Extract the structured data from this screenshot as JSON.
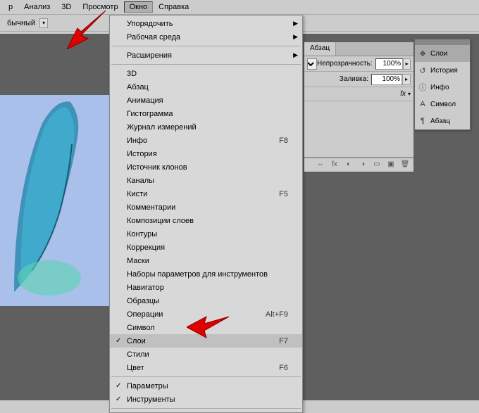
{
  "menubar": {
    "items": [
      "р",
      "Анализ",
      "3D",
      "Просмотр",
      "Окно",
      "Справка"
    ],
    "pressed_index": 4
  },
  "optbar": {
    "label": "бычный"
  },
  "dropdown": {
    "groups": [
      [
        {
          "label": "Упорядочить",
          "sub": true
        },
        {
          "label": "Рабочая среда",
          "sub": true
        }
      ],
      [
        {
          "label": "Расширения",
          "sub": true
        }
      ],
      [
        {
          "label": "3D"
        },
        {
          "label": "Абзац"
        },
        {
          "label": "Анимация"
        },
        {
          "label": "Гистограмма"
        },
        {
          "label": "Журнал измерений"
        },
        {
          "label": "Инфо",
          "shortcut": "F8"
        },
        {
          "label": "История"
        },
        {
          "label": "Источник клонов"
        },
        {
          "label": "Каналы"
        },
        {
          "label": "Кисти",
          "shortcut": "F5"
        },
        {
          "label": "Комментарии"
        },
        {
          "label": "Композиции слоев"
        },
        {
          "label": "Контуры"
        },
        {
          "label": "Коррекция"
        },
        {
          "label": "Маски"
        },
        {
          "label": "Наборы параметров для инструментов"
        },
        {
          "label": "Навигатор"
        },
        {
          "label": "Образцы"
        },
        {
          "label": "Операции",
          "shortcut": "Alt+F9"
        },
        {
          "label": "Символ"
        },
        {
          "label": "Слои",
          "shortcut": "F7",
          "checked": true,
          "highlight": true
        },
        {
          "label": "Стили"
        },
        {
          "label": "Цвет",
          "shortcut": "F6"
        }
      ],
      [
        {
          "label": "Параметры",
          "checked": true
        },
        {
          "label": "Инструменты",
          "checked": true
        }
      ]
    ]
  },
  "panel": {
    "tab": "Абзац",
    "opacity_label": "Непрозрачность:",
    "opacity_value": "100%",
    "fill_label": "Заливка:",
    "fill_value": "100%",
    "fx": "fx"
  },
  "float": {
    "items": [
      {
        "icon": "layers",
        "label": "Слои",
        "selected": true
      },
      {
        "icon": "history",
        "label": "История"
      },
      {
        "icon": "info",
        "label": "Инфо"
      },
      {
        "icon": "char",
        "label": "Символ"
      },
      {
        "icon": "para",
        "label": "Абзац"
      }
    ]
  }
}
